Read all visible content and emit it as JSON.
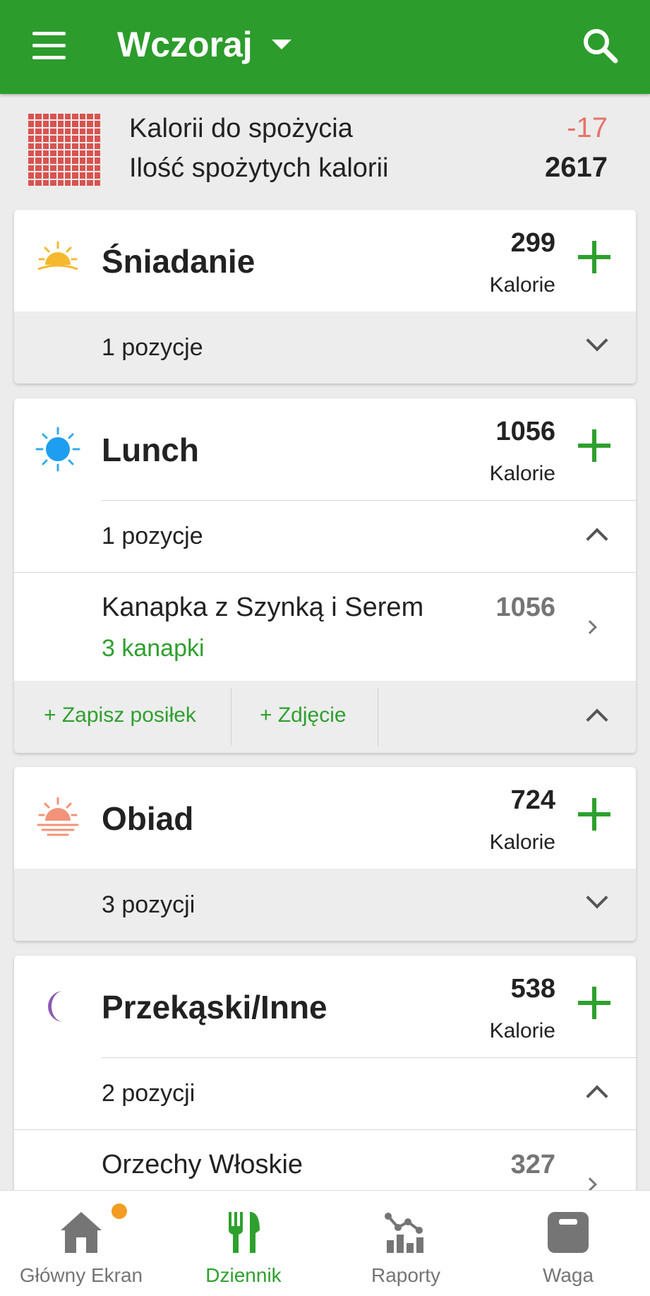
{
  "app_bar": {
    "title": "Wczoraj",
    "menu_icon": "hamburger-icon",
    "dropdown_icon": "caret-down-icon",
    "search_icon": "search-icon",
    "color": "#2c9c2c"
  },
  "summary": {
    "remaining_label": "Kalorii do spożycia",
    "remaining_value": "-17",
    "consumed_label": "Ilość spożytych kalorii",
    "consumed_value": "2617",
    "remaining_color": "#e57368"
  },
  "meals": [
    {
      "name": "Śniadanie",
      "icon": "sunrise-icon",
      "kcal": "299",
      "kcal_label": "Kalorie",
      "items_count": "1 pozycje",
      "expanded": false
    },
    {
      "name": "Lunch",
      "icon": "sun-icon",
      "kcal": "1056",
      "kcal_label": "Kalorie",
      "items_count": "1 pozycje",
      "expanded": true,
      "foods": [
        {
          "name": "Kanapka z Szynką i Serem",
          "kcal": "1056",
          "portion": "3  kanapki"
        }
      ],
      "actions": {
        "save_meal": "+ Zapisz posiłek",
        "photo": "+ Zdjęcie"
      }
    },
    {
      "name": "Obiad",
      "icon": "sunset-icon",
      "kcal": "724",
      "kcal_label": "Kalorie",
      "items_count": "3 pozycji",
      "expanded": false
    },
    {
      "name": "Przekąski/Inne",
      "icon": "moon-icon",
      "kcal": "538",
      "kcal_label": "Kalorie",
      "items_count": "2 pozycji",
      "expanded": true,
      "foods": [
        {
          "name": "Orzechy Włoskie",
          "kcal": "327"
        }
      ]
    }
  ],
  "bottom_nav": [
    {
      "label": "Główny Ekran",
      "icon": "home-icon",
      "active": false,
      "badge": true
    },
    {
      "label": "Dziennik",
      "icon": "fork-knife-icon",
      "active": true
    },
    {
      "label": "Raporty",
      "icon": "chart-icon",
      "active": false
    },
    {
      "label": "Waga",
      "icon": "scale-icon",
      "active": false
    }
  ],
  "accent_color": "#2ea02e"
}
